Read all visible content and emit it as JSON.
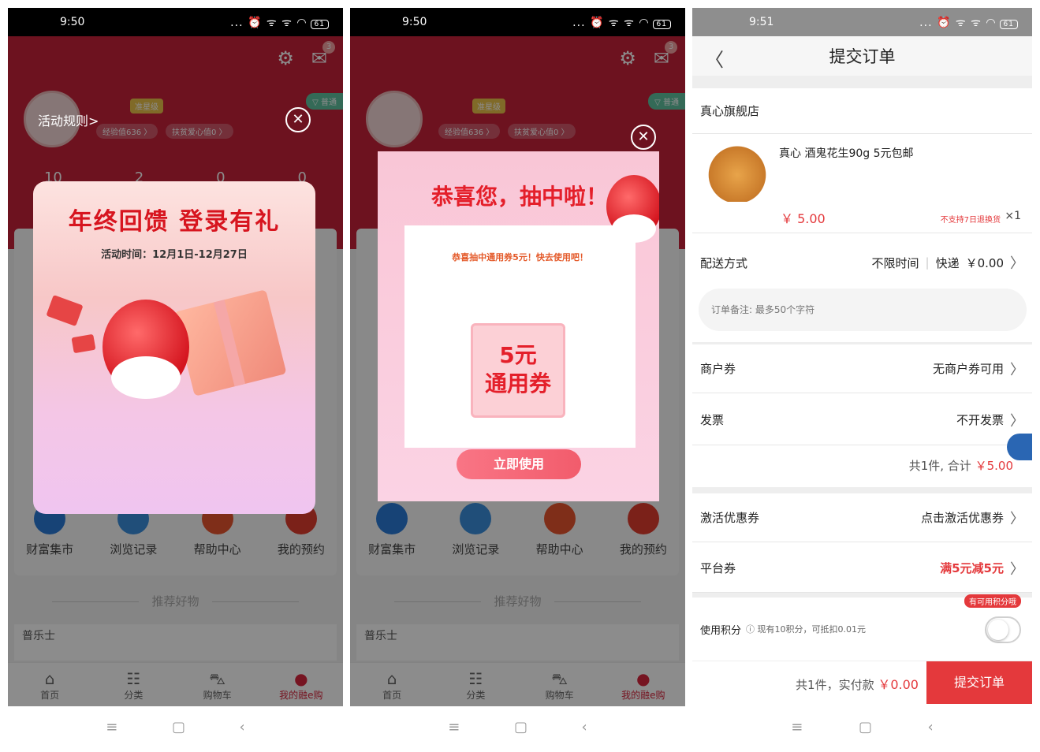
{
  "phone1": {
    "status": {
      "time": "9:50",
      "icons": "... ⏰ ᯤ ᯤ ◠",
      "battery": "61"
    },
    "msg_count": "3",
    "level_badge": "准星级",
    "exp_pill": "经验值636 〉",
    "love_pill": "扶贫爱心值0 〉",
    "vip": "▽ 普通",
    "stats": [
      "10",
      "2",
      "0",
      "0"
    ],
    "rules_link": "活动规则>",
    "popup_title": "年终回馈 登录有礼",
    "popup_sub": "活动时间：12月1日-12月27日",
    "shortcuts": [
      "财富集市",
      "浏览记录",
      "帮助中心",
      "我的预约"
    ],
    "rec_title": "推荐好物",
    "brand": "普乐士",
    "tabs": [
      "首页",
      "分类",
      "购物车",
      "我的融e购"
    ],
    "icon_home": "⌂",
    "icon_category": "☷",
    "icon_cart": "⛍",
    "icon_me": "●"
  },
  "phone2": {
    "status": {
      "time": "9:50",
      "icons": "... ⏰ ᯤ ᯤ ◠",
      "battery": "61"
    },
    "popup_title": "恭喜您，抽中啦！",
    "popup_msg": "恭喜抽中通用券5元！快去使用吧！",
    "coupon_line1": "5元",
    "coupon_line2": "通用券",
    "use_button": "立即使用",
    "shortcuts": [
      "财富集市",
      "浏览记录",
      "帮助中心",
      "我的预约"
    ],
    "rec_title": "推荐好物",
    "brand": "普乐士",
    "tabs": [
      "首页",
      "分类",
      "购物车",
      "我的融e购"
    ]
  },
  "phone3": {
    "status": {
      "time": "9:51",
      "icons": "... ⏰ ᯤ ᯤ ◠",
      "battery": "61"
    },
    "page_title": "提交订单",
    "shop_name": "真心旗舰店",
    "product_title": "真心 酒鬼花生90g 5元包邮",
    "product_price": "￥ 5.00",
    "product_note": "不支持7日退换货",
    "product_qty": "×1",
    "delivery_label": "配送方式",
    "delivery_time": "不限时间",
    "delivery_method": "快递",
    "delivery_fee": "￥0.00",
    "remark_placeholder": "订单备注: 最多50个字符",
    "merchant_coupon_label": "商户券",
    "merchant_coupon_value": "无商户券可用",
    "invoice_label": "发票",
    "invoice_value": "不开发票",
    "summary_count": "共1件,  合计",
    "summary_amount": "￥5.00",
    "activate_label": "激活优惠券",
    "activate_value": "点击激活优惠券",
    "platform_label": "平台券",
    "platform_value": "满5元减5元",
    "points_label": "使用积分",
    "points_hint": "ⓘ 现有10积分，可抵扣0.01元",
    "points_badge": "有可用积分哦",
    "pay_label": "共1件，实付款",
    "pay_amount": "￥0.00",
    "submit_label": "提交订单"
  },
  "nav": {
    "menu": "≡",
    "home": "▢",
    "back": "‹"
  },
  "colors": {
    "brand_red": "#e4393c",
    "profile_red": "#c6213a"
  }
}
